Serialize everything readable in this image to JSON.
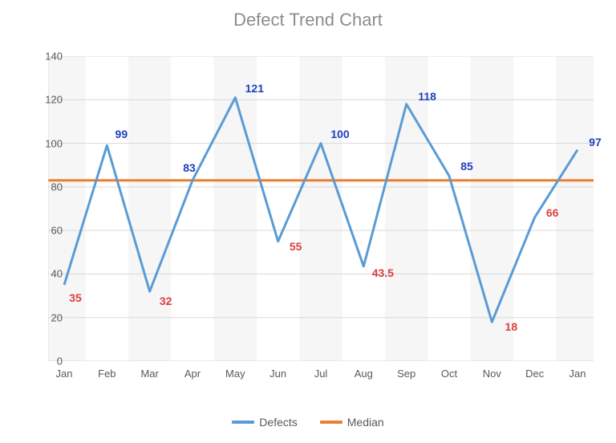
{
  "chart_data": {
    "type": "line",
    "title": "Defect Trend Chart",
    "xlabel": "",
    "ylabel": "",
    "ylim": [
      0,
      140
    ],
    "y_ticks": [
      0,
      20,
      40,
      60,
      80,
      100,
      120,
      140
    ],
    "categories": [
      "Jan",
      "Feb",
      "Mar",
      "Apr",
      "May",
      "Jun",
      "Jul",
      "Aug",
      "Sep",
      "Oct",
      "Nov",
      "Dec",
      "Jan"
    ],
    "series": [
      {
        "name": "Defects",
        "color": "#5b9bd5",
        "values": [
          35,
          99,
          32,
          83,
          121,
          55,
          100,
          43.5,
          118,
          85,
          18,
          66,
          97
        ],
        "labels": [
          {
            "text": "35",
            "color": "red",
            "dx": 14,
            "dy": 16
          },
          {
            "text": "99",
            "color": "blue",
            "dx": 18,
            "dy": -14
          },
          {
            "text": "32",
            "color": "red",
            "dx": 20,
            "dy": 12
          },
          {
            "text": "83",
            "color": "blue",
            "dx": -4,
            "dy": -16
          },
          {
            "text": "121",
            "color": "blue",
            "dx": 24,
            "dy": -12
          },
          {
            "text": "55",
            "color": "red",
            "dx": 22,
            "dy": 6
          },
          {
            "text": "100",
            "color": "blue",
            "dx": 24,
            "dy": -12
          },
          {
            "text": "43.5",
            "color": "red",
            "dx": 24,
            "dy": 8
          },
          {
            "text": "118",
            "color": "blue",
            "dx": 26,
            "dy": -10
          },
          {
            "text": "85",
            "color": "blue",
            "dx": 22,
            "dy": -12
          },
          {
            "text": "18",
            "color": "red",
            "dx": 24,
            "dy": 6
          },
          {
            "text": "66",
            "color": "red",
            "dx": 22,
            "dy": -6
          },
          {
            "text": "97",
            "color": "blue",
            "dx": 22,
            "dy": -10
          }
        ]
      },
      {
        "name": "Median",
        "color": "#ed7d31",
        "constant_value": 83
      }
    ],
    "legend": [
      "Defects",
      "Median"
    ]
  }
}
